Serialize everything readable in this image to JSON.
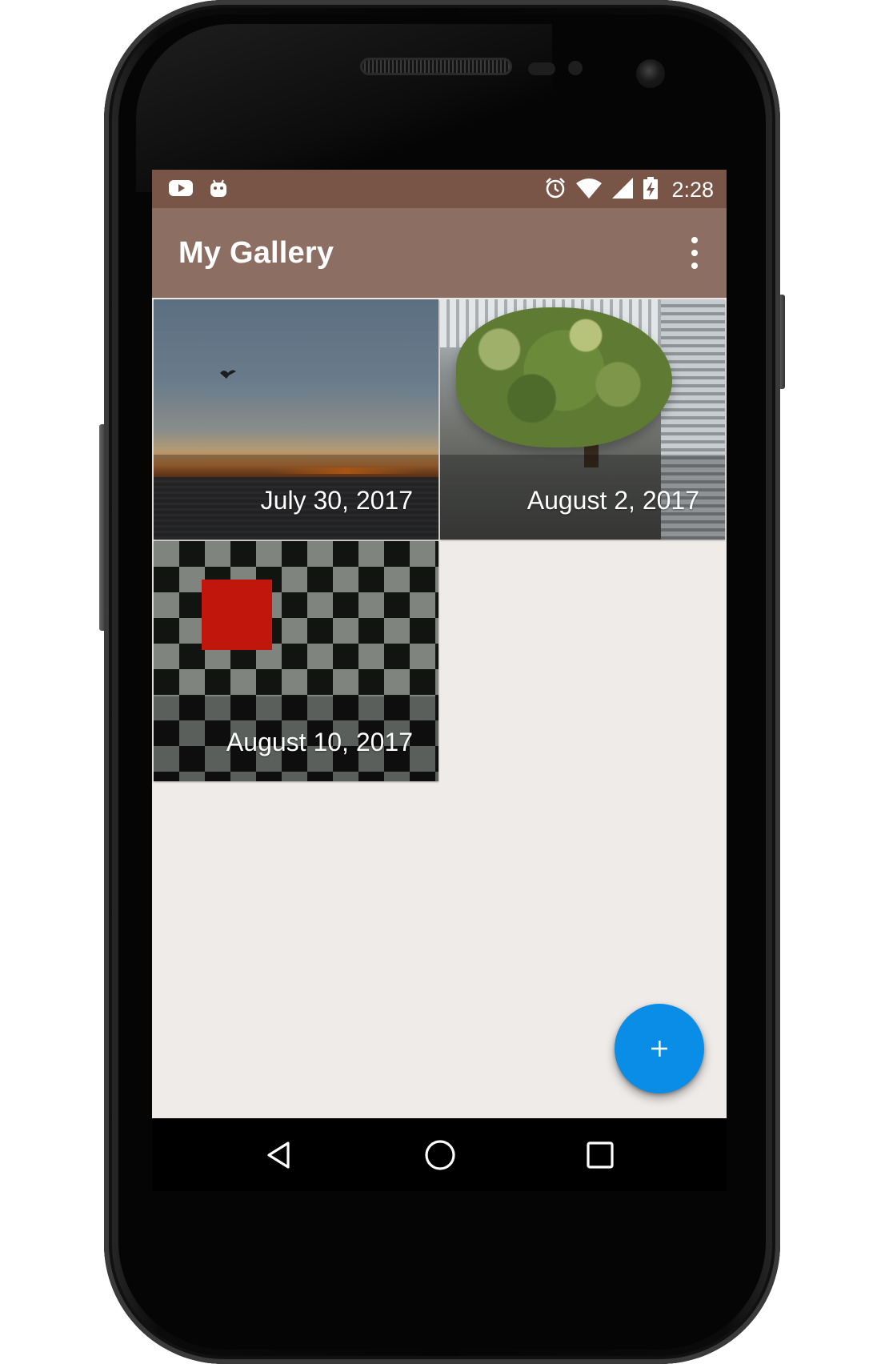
{
  "device": {
    "icons": [
      "earpiece-speaker",
      "proximity-sensor",
      "light-sensor",
      "front-camera"
    ]
  },
  "status_bar": {
    "time": "2:28",
    "left_icons": [
      "youtube-notification-icon",
      "android-notification-icon"
    ],
    "right_icons": [
      "alarm-icon",
      "wifi-icon",
      "cell-signal-icon",
      "battery-charging-icon"
    ],
    "color": "#795548"
  },
  "app_bar": {
    "title": "My Gallery",
    "overflow_icon": "more-vert-icon",
    "color": "#8d6e63"
  },
  "gallery": {
    "items": [
      {
        "date": "July 30, 2017",
        "image": "sunset-over-ocean-with-bird"
      },
      {
        "date": "August 2, 2017",
        "image": "tree-in-courtyard"
      },
      {
        "date": "August 10, 2017",
        "image": "checkerboard-with-red-square"
      }
    ]
  },
  "fab": {
    "icon": "add-icon",
    "label": "+",
    "color": "#0a8de6"
  },
  "nav_bar": {
    "buttons": [
      "back-icon",
      "home-icon",
      "recents-icon"
    ]
  },
  "colors": {
    "background": "#efebe9",
    "caption_text": "#ffffff"
  }
}
